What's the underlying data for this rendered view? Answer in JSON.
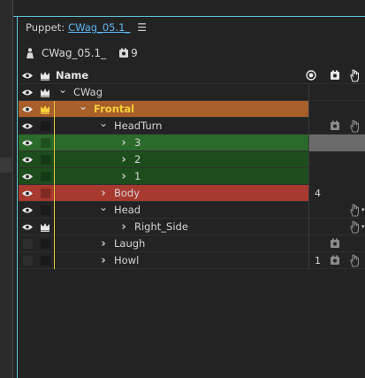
{
  "panel": {
    "tab_label": "Puppet:",
    "tab_puppet_link": "CWag_05.1_",
    "menu_icon": "hamburger-menu-icon"
  },
  "puppet": {
    "name": "CWag_05.1_",
    "count": "9"
  },
  "header": {
    "name_label": "Name"
  },
  "rows": [
    {
      "label": "CWag",
      "indent": 0,
      "chevron": "down",
      "eye": true,
      "crown": true,
      "style": "plain"
    },
    {
      "label": "Frontal",
      "indent": 1,
      "chevron": "down",
      "eye": true,
      "crown": true,
      "style": "orange"
    },
    {
      "label": "HeadTurn",
      "indent": 2,
      "chevron": "down",
      "eye": true,
      "crown": false,
      "style": "plain",
      "cam": true,
      "hand": true
    },
    {
      "label": "3",
      "indent": 3,
      "chevron": "right",
      "eye": true,
      "crown": false,
      "style": "green-bright"
    },
    {
      "label": "2",
      "indent": 3,
      "chevron": "right",
      "eye": true,
      "crown": false,
      "style": "green"
    },
    {
      "label": "1",
      "indent": 3,
      "chevron": "right",
      "eye": true,
      "crown": false,
      "style": "green"
    },
    {
      "label": "Body",
      "indent": 2,
      "chevron": "right",
      "eye": true,
      "crown": false,
      "style": "red",
      "num": "4"
    },
    {
      "label": "Head",
      "indent": 2,
      "chevron": "down",
      "eye": true,
      "crown": false,
      "style": "plain",
      "hand_dd": true
    },
    {
      "label": "Right_Side",
      "indent": 3,
      "chevron": "right",
      "eye": true,
      "crown": true,
      "style": "plain",
      "hand_dd": true
    },
    {
      "label": "Laugh",
      "indent": 2,
      "chevron": "right",
      "eye": false,
      "crown": false,
      "style": "plain",
      "cam": true
    },
    {
      "label": "Howl",
      "indent": 2,
      "chevron": "right",
      "eye": false,
      "crown": false,
      "style": "plain",
      "num": "1",
      "cam": true,
      "hand": true
    }
  ],
  "colors": {
    "accent_link": "#5fb6f0",
    "selected_orange": "#a85f2a",
    "selected_text": "#f5d03a",
    "green_bright": "#2a6a2a",
    "green": "#1d4d1d",
    "red": "#a8392e"
  }
}
